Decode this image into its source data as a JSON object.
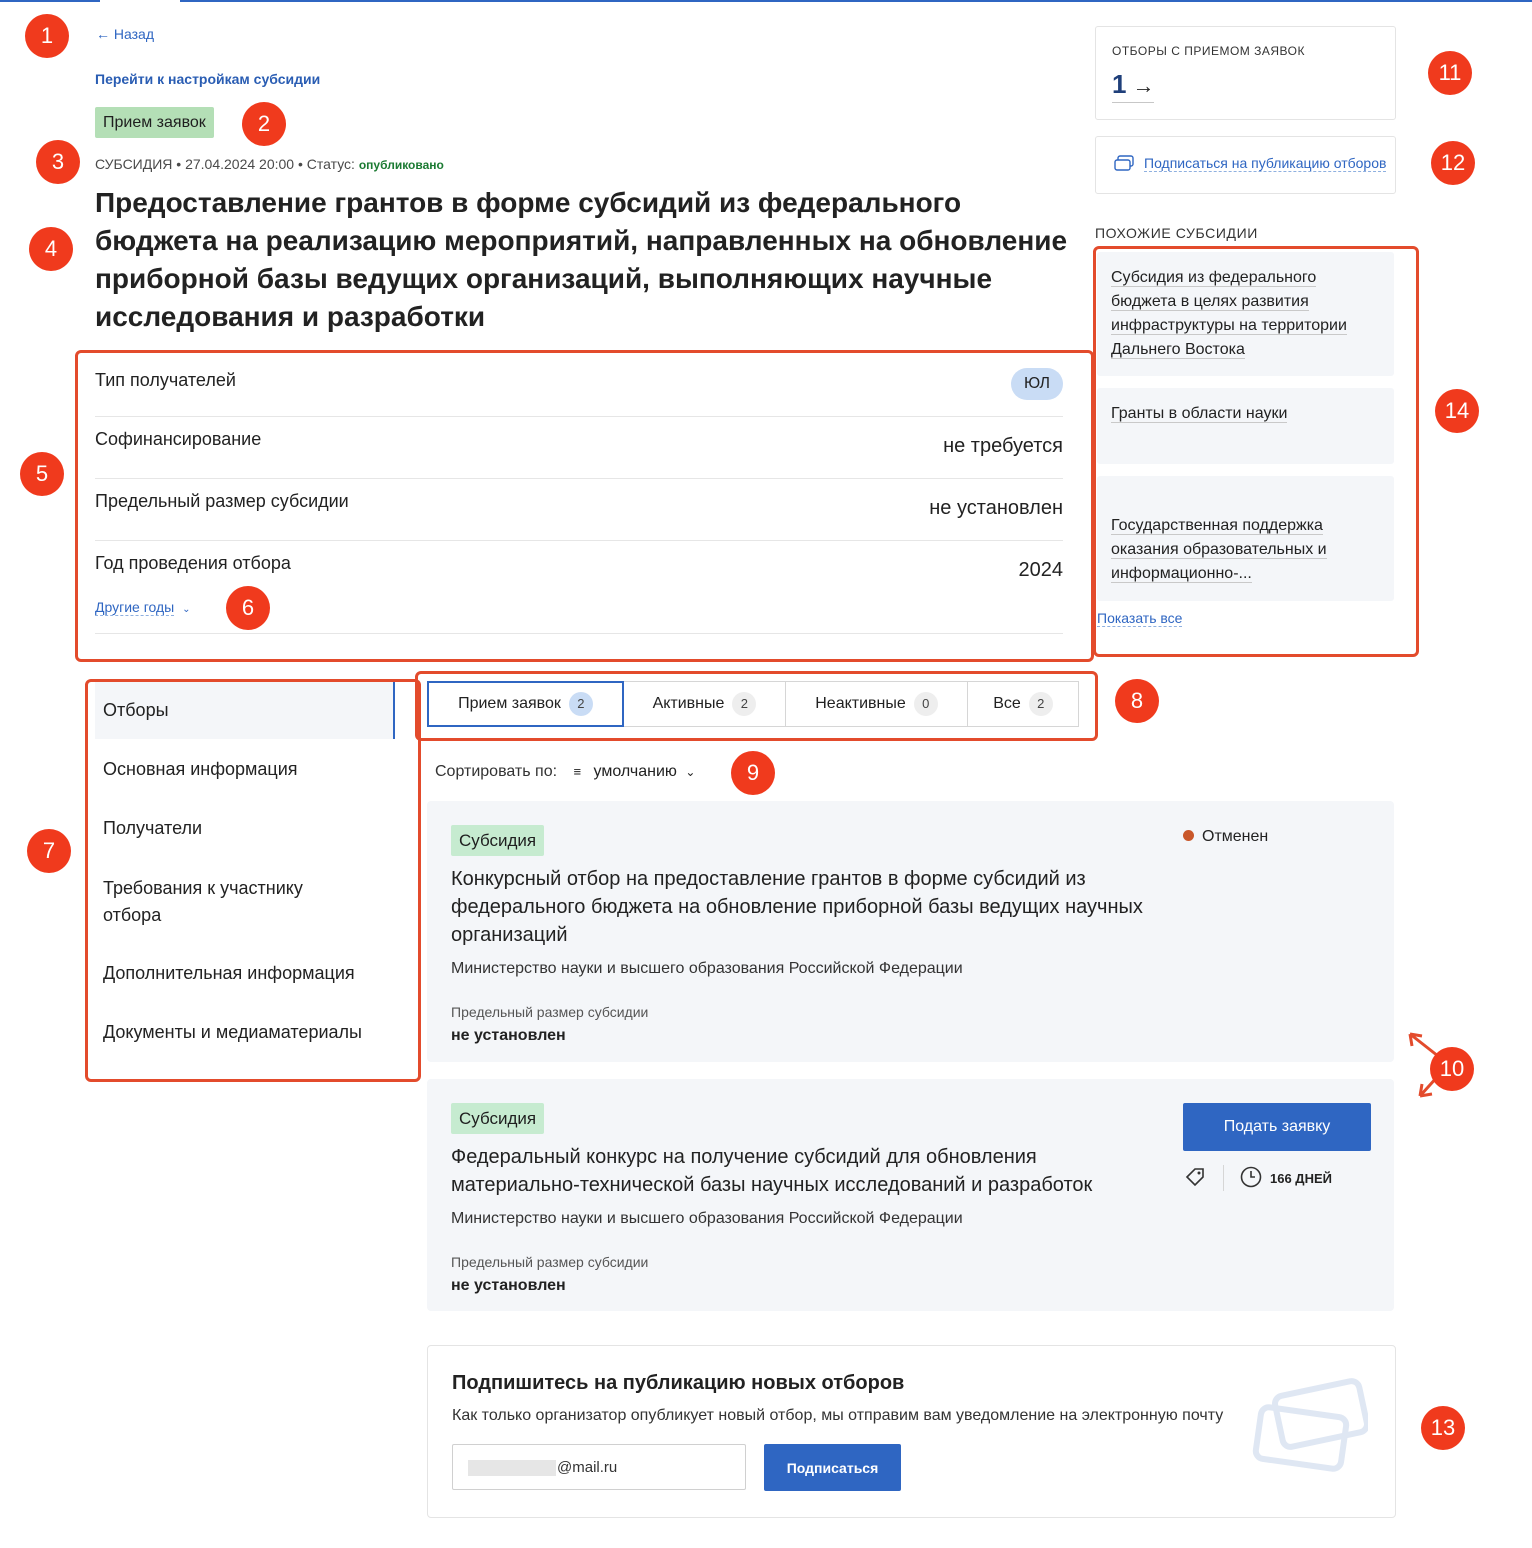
{
  "nav_back": "Назад",
  "settings_link": "Перейти к настройкам субсидии",
  "status_badge": "Прием заявок",
  "meta": {
    "type": "СУБСИДИЯ",
    "datetime": "27.04.2024 20:00",
    "status_label": "Статус:",
    "status_value": "опубликовано"
  },
  "title": "Предоставление грантов в форме субсидий из федерального бюджета на реализацию мероприятий, направленных на обновление приборной базы ведущих организаций, выполняющих научные исследования и разработки",
  "properties": [
    {
      "label": "Тип получателей",
      "value": "ЮЛ"
    },
    {
      "label": "Софинансирование",
      "value": "не требуется"
    },
    {
      "label": "Предельный размер субсидии",
      "value": "не установлен"
    },
    {
      "label": "Год проведения отбора",
      "value": "2024"
    }
  ],
  "other_years": "Другие годы",
  "side_nav": [
    {
      "label": "Отборы"
    },
    {
      "label": "Основная информация"
    },
    {
      "label": "Получатели"
    },
    {
      "label": "Требования к участнику отбора"
    },
    {
      "label": "Дополнительная информация"
    },
    {
      "label": "Документы и медиаматериалы"
    }
  ],
  "tabs": [
    {
      "label": "Прием заявок",
      "count": "2"
    },
    {
      "label": "Активные",
      "count": "2"
    },
    {
      "label": "Неактивные",
      "count": "0"
    },
    {
      "label": "Все",
      "count": "2"
    }
  ],
  "sort": {
    "label": "Сортировать по:",
    "value": "умолчанию"
  },
  "cards": [
    {
      "type": "Субсидия",
      "title": "Конкурсный отбор на предоставление грантов в форме субсидий из федерального бюджета на обновление приборной базы ведущих научных организаций",
      "org": "Министерство науки и высшего образования Российской Федерации",
      "limit_label": "Предельный размер субсидии",
      "limit_value": "не установлен",
      "status": "Отменен"
    },
    {
      "type": "Субсидия",
      "title": "Федеральный конкурс на получение субсидий для обновления материально-технической базы научных исследований и разработок",
      "org": "Министерство науки и высшего образования Российской Федерации",
      "limit_label": "Предельный размер субсидии",
      "limit_value": "не установлен",
      "action": "Подать заявку",
      "days": "166 ДНЕЙ"
    }
  ],
  "subscribe": {
    "title": "Подпишитесь на публикацию новых отборов",
    "desc": "Как только организатор опубликует новый отбор, мы отправим вам уведомление на электронную почту",
    "email": "@mail.ru",
    "button": "Подписаться"
  },
  "selections_box": {
    "label": "ОТБОРЫ С ПРИЕМОМ ЗАЯВОК",
    "count": "1"
  },
  "subscribe_link": "Подписаться на публикацию отборов",
  "similar": {
    "heading": "ПОХОЖИЕ СУБСИДИИ",
    "items": [
      "Субсидия из федерального бюджета в целях развития инфраструктуры на территории Дальнего Востока",
      "Гранты в области науки",
      "Государственная поддержка оказания образовательных и информационно-..."
    ],
    "show_all": "Показать все"
  },
  "markers": [
    "1",
    "2",
    "3",
    "4",
    "5",
    "6",
    "7",
    "8",
    "9",
    "10",
    "11",
    "12",
    "13",
    "14"
  ],
  "colors": {
    "accent": "#2f66c2",
    "annotation": "#f03a1d",
    "badge_green": "#b4dfb6",
    "canceled_dot": "#c9572a"
  }
}
